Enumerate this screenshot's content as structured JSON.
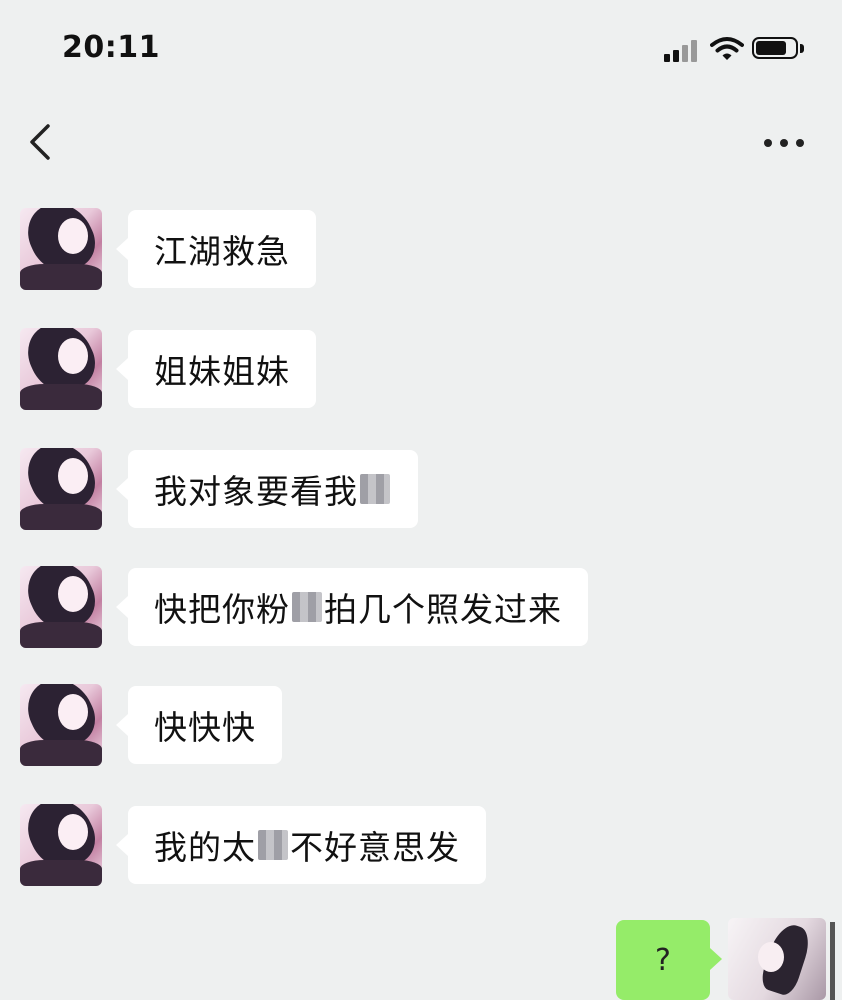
{
  "status_bar": {
    "time": "20:11"
  },
  "nav": {
    "back_icon": "chevron-left-icon",
    "more_icon": "more-dots-icon"
  },
  "messages": [
    {
      "parts": [
        "江湖救急"
      ]
    },
    {
      "parts": [
        "姐妹姐妹"
      ]
    },
    {
      "parts": [
        "我对象要看我"
      ],
      "mosaic_after": true
    },
    {
      "parts": [
        "快把你粉",
        "拍几个照发过来"
      ]
    },
    {
      "parts": [
        "快快快"
      ]
    },
    {
      "parts": [
        "我的太",
        "不好意思发"
      ]
    }
  ],
  "outgoing": {
    "text": "?"
  },
  "colors": {
    "background": "#eef0f0",
    "incoming_bubble": "#ffffff",
    "outgoing_bubble": "#95ec69"
  }
}
